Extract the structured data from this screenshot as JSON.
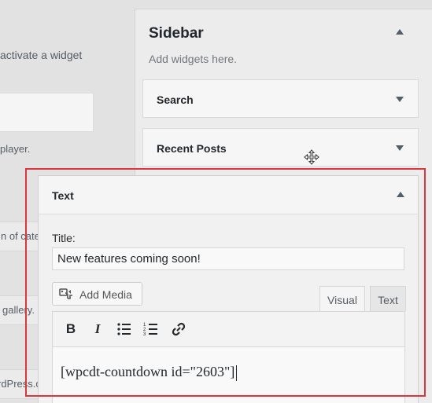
{
  "left": {
    "frag_activate": "activate a widget",
    "frag_player": "player.",
    "frag_categ": "n of categ",
    "frag_gallery": "gallery.",
    "frag_wordpress": "rdPress.o"
  },
  "sidebar": {
    "title": "Sidebar",
    "description": "Add widgets here.",
    "widgets": [
      {
        "title": "Search"
      },
      {
        "title": "Recent Posts"
      }
    ]
  },
  "text_widget": {
    "title": "Text",
    "title_label": "Title:",
    "title_value": "New features coming soon!",
    "add_media_label": "Add Media",
    "tabs": {
      "visual": "Visual",
      "text": "Text"
    },
    "toolbar": {
      "bold": "B",
      "italic": "I"
    },
    "content": "[wpcdt-countdown id=\"2603\"]"
  },
  "colors": {
    "highlight": "#d9363e",
    "background": "#e2e2e2"
  },
  "icons": {
    "collapse": "caret-up-icon",
    "expand": "caret-down-icon",
    "media": "add-media-icon",
    "move": "move-cursor-icon",
    "bullet_list": "bulleted-list-icon",
    "numbered_list": "numbered-list-icon",
    "link": "link-icon"
  }
}
